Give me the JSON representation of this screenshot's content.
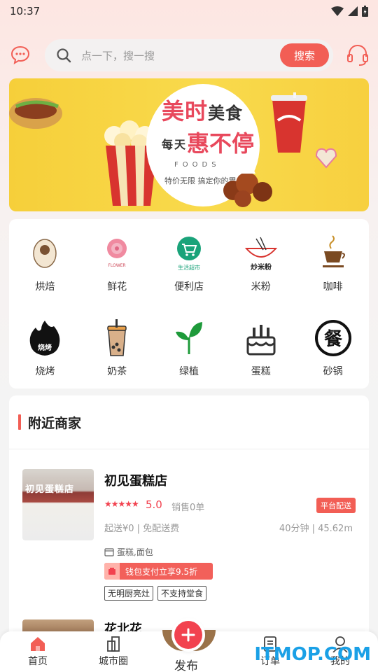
{
  "status": {
    "time": "10:37"
  },
  "search": {
    "placeholder": "点一下，搜一搜",
    "button": "搜索"
  },
  "banner": {
    "title_a": "美时",
    "title_b": "美食",
    "title_c1": "每",
    "title_c2": "天",
    "title_d": "惠不停",
    "foods": "FOODS",
    "slogan": "特价无限 搞定你的胃"
  },
  "categories": [
    {
      "label": "烘焙",
      "icon": "baking-icon"
    },
    {
      "label": "鲜花",
      "icon": "flower-icon"
    },
    {
      "label": "便利店",
      "icon": "convenience-store-icon"
    },
    {
      "label": "米粉",
      "icon": "rice-noodle-icon"
    },
    {
      "label": "咖啡",
      "icon": "coffee-icon"
    },
    {
      "label": "烧烤",
      "icon": "barbecue-icon"
    },
    {
      "label": "奶茶",
      "icon": "milk-tea-icon"
    },
    {
      "label": "绿植",
      "icon": "plant-icon"
    },
    {
      "label": "蛋糕",
      "icon": "cake-icon"
    },
    {
      "label": "砂锅",
      "icon": "casserole-icon"
    }
  ],
  "category_icon_text": {
    "convenience": "生活超市",
    "ricenoodle": "炒米粉",
    "flower": "FLOWER",
    "bbq": "烧烤",
    "casserole": "餐"
  },
  "nearby": {
    "title": "附近商家",
    "shops": [
      {
        "name": "初见蛋糕店",
        "sign": "初见蛋糕店",
        "stars": "★★★★★",
        "rating": "5.0",
        "sales": "销售0单",
        "delivery": "平台配送",
        "fee": "起送¥0 | 免配送费",
        "distance": "40分钟 | 45.62m",
        "tags": "蛋糕,面包",
        "promo": "钱包支付立享9.5折",
        "labels": [
          "无明厨亮灶",
          "不支持堂食"
        ]
      },
      {
        "name": "花北花"
      }
    ]
  },
  "tabs": {
    "home": "首页",
    "city": "城市圈",
    "publish": "发布",
    "orders": "订单",
    "mine": "我的"
  },
  "watermark": "ITMOP.COM",
  "colors": {
    "accent": "#f25e55",
    "star": "#f2424f",
    "watermark": "#1aa0e6"
  }
}
